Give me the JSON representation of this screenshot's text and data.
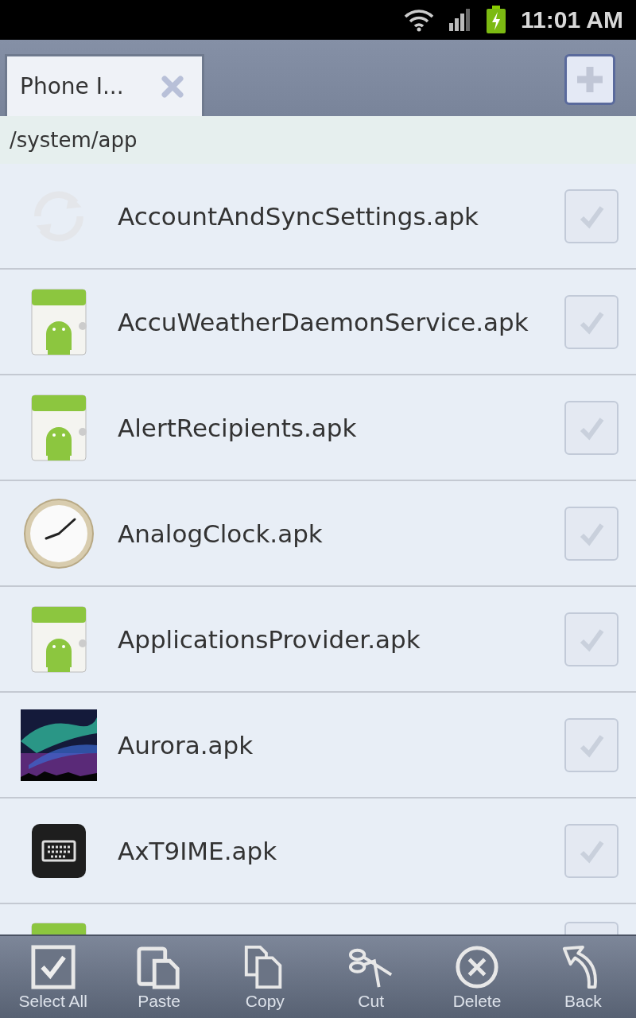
{
  "status_bar": {
    "time": "11:01 AM",
    "charging": true
  },
  "tabs": [
    {
      "label": "Phone I...",
      "selected": true
    }
  ],
  "path": "/system/app",
  "files": [
    {
      "name": "AccountAndSyncSettings.apk",
      "kind": "sync",
      "checked": false
    },
    {
      "name": "AccuWeatherDaemonService.apk",
      "kind": "android",
      "checked": false
    },
    {
      "name": "AlertRecipients.apk",
      "kind": "android",
      "checked": false
    },
    {
      "name": "AnalogClock.apk",
      "kind": "clock",
      "checked": false
    },
    {
      "name": "ApplicationsProvider.apk",
      "kind": "android",
      "checked": false
    },
    {
      "name": "Aurora.apk",
      "kind": "picture",
      "checked": false
    },
    {
      "name": "AxT9IME.apk",
      "kind": "keyboard",
      "checked": false
    },
    {
      "kind": "android",
      "checked": false
    }
  ],
  "toolbar": [
    {
      "label": "Select All",
      "kind": "select"
    },
    {
      "label": "Paste",
      "kind": "paste"
    },
    {
      "label": "Copy",
      "kind": "copy"
    },
    {
      "label": "Cut",
      "kind": "cut"
    },
    {
      "label": "Delete",
      "kind": "delete"
    },
    {
      "label": "Back",
      "kind": "back"
    }
  ]
}
